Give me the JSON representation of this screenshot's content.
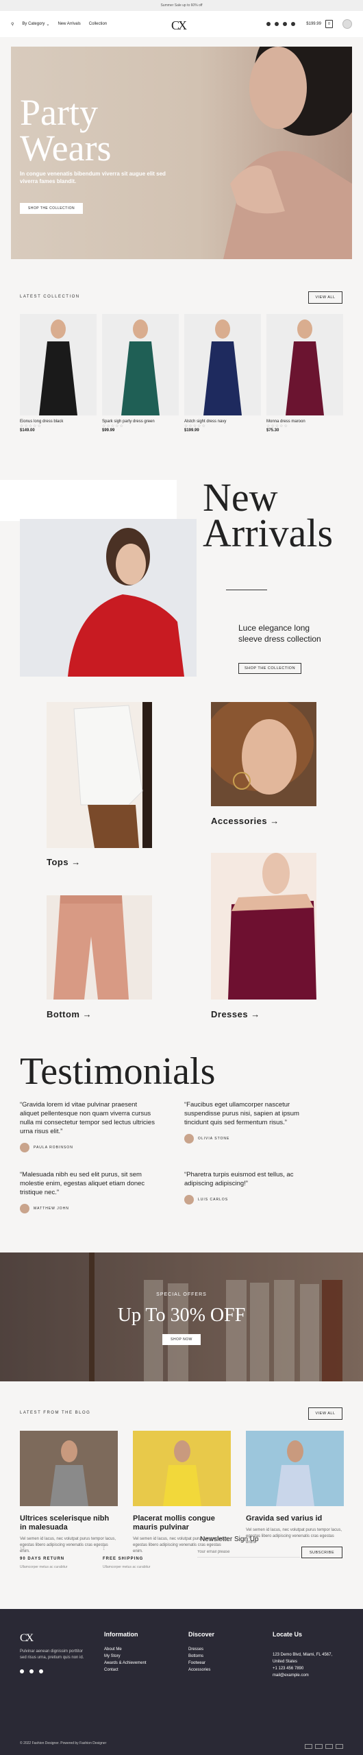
{
  "topbar": {
    "text": "Summer Sale up to 60% off"
  },
  "header": {
    "nav": [
      "By Category",
      "New Arrivals",
      "Collection"
    ],
    "logo": "CX",
    "price": "$199.99",
    "cart_count": "0"
  },
  "hero": {
    "title_line1": "Party",
    "title_line2": "Wears",
    "subtitle": "In congue venenatis bibendum viverra sit augue elit sed viverra fames blandit.",
    "button": "SHOP THE COLLECTION"
  },
  "latest": {
    "label": "LATEST COLLECTION",
    "view_all": "VIEW ALL",
    "products": [
      {
        "name": "Eionus long dress black",
        "stars": "☆☆☆☆☆",
        "price": "$149.00",
        "dress": "#1a1a1a"
      },
      {
        "name": "Spark sigh party dress green",
        "stars": "☆☆☆☆☆",
        "price": "$99.99",
        "dress": "#1f5f55"
      },
      {
        "name": "Alstch sight dress navy",
        "stars": "☆☆☆☆☆",
        "price": "$199.99",
        "dress": "#1e2a5e"
      },
      {
        "name": "Monna dress maroon",
        "stars": "☆☆☆☆☆",
        "price": "$75.30",
        "dress": "#6b1430"
      }
    ]
  },
  "arrivals": {
    "title_line1": "New",
    "title_line2": "Arrivals",
    "product": "Luce elegance long sleeve dress collection",
    "button": "SHOP THE COLLECTION"
  },
  "categories": {
    "tops": "Tops",
    "accessories": "Accessories",
    "bottom": "Bottom",
    "dresses": "Dresses",
    "arrow": "→"
  },
  "testimonials": {
    "title": "Testimonials",
    "items": [
      {
        "quote": "“Gravida lorem id vitae pulvinar praesent aliquet pellentesque non quam viverra cursus nulla mi consectetur tempor sed lectus ultricies urna risus elit.”",
        "author": "PAULA ROBINSON"
      },
      {
        "quote": "“Faucibus eget ullamcorper nascetur suspendisse purus nisi, sapien at ipsum tincidunt quis sed fermentum risus.”",
        "author": "OLIVIA STONE"
      },
      {
        "quote": "“Malesuada nibh eu sed elit purus, sit sem molestie enim, egestas aliquet etiam donec tristique nec.”",
        "author": "MATTHEW JOHN"
      },
      {
        "quote": "“Pharetra turpis euismod est tellus, ac adipiscing adipiscing!”",
        "author": "LUIS CARLOS"
      }
    ]
  },
  "promo": {
    "label": "SPECIAL OFFERS",
    "title": "Up To 30% OFF",
    "button": "SHOP NOW"
  },
  "blog": {
    "label": "LATEST FROM THE BLOG",
    "view_all": "VIEW ALL",
    "posts": [
      {
        "title": "Ultrices scelerisque nibh in malesuada",
        "excerpt": "Vel semen id lacus, nec volutpat purus tempor lacus, egestas libero adipiscing venenatis cras egestas enim."
      },
      {
        "title": "Placerat mollis congue mauris pulvinar",
        "excerpt": "Vel semen id lacus, nec volutpat purus tempor lacus, egestas libero adipiscing venenatis cras egestas enim."
      },
      {
        "title": "Gravida sed varius id",
        "excerpt": "Vel semen id lacus, nec volutpat purus tempor lacus, egestas libero adipiscing venenatis cras egestas enim."
      }
    ]
  },
  "features": {
    "returns": "90 DAYS RETURN",
    "returns_sub": "Ullamcorper metus ac curabitur",
    "shipping": "FREE SHIPPING",
    "shipping_sub": "Ullamcorper metus ac curabitur"
  },
  "newsletter": {
    "title": "Newsletter Sign Up",
    "placeholder": "Your email please",
    "button": "SUBSCRIBE"
  },
  "footer": {
    "logo": "CX",
    "about": "Pulvinar aenean dignissim porttitor sed risus urna, pretium quis non id.",
    "info_title": "Information",
    "info": [
      "About Me",
      "My Story",
      "Awards & Achievement",
      "Contact"
    ],
    "discover_title": "Discover",
    "discover": [
      "Dresses",
      "Bottoms",
      "Footwear",
      "Accessories"
    ],
    "locate_title": "Locate Us",
    "locate": [
      "123 Demo Blvd, Miami, FL 4567,",
      "United States",
      "+1 123 456 7890",
      "mail@example.com"
    ],
    "copyright": "© 2022 Fashion Designer. Powered by Fashion Designer"
  }
}
